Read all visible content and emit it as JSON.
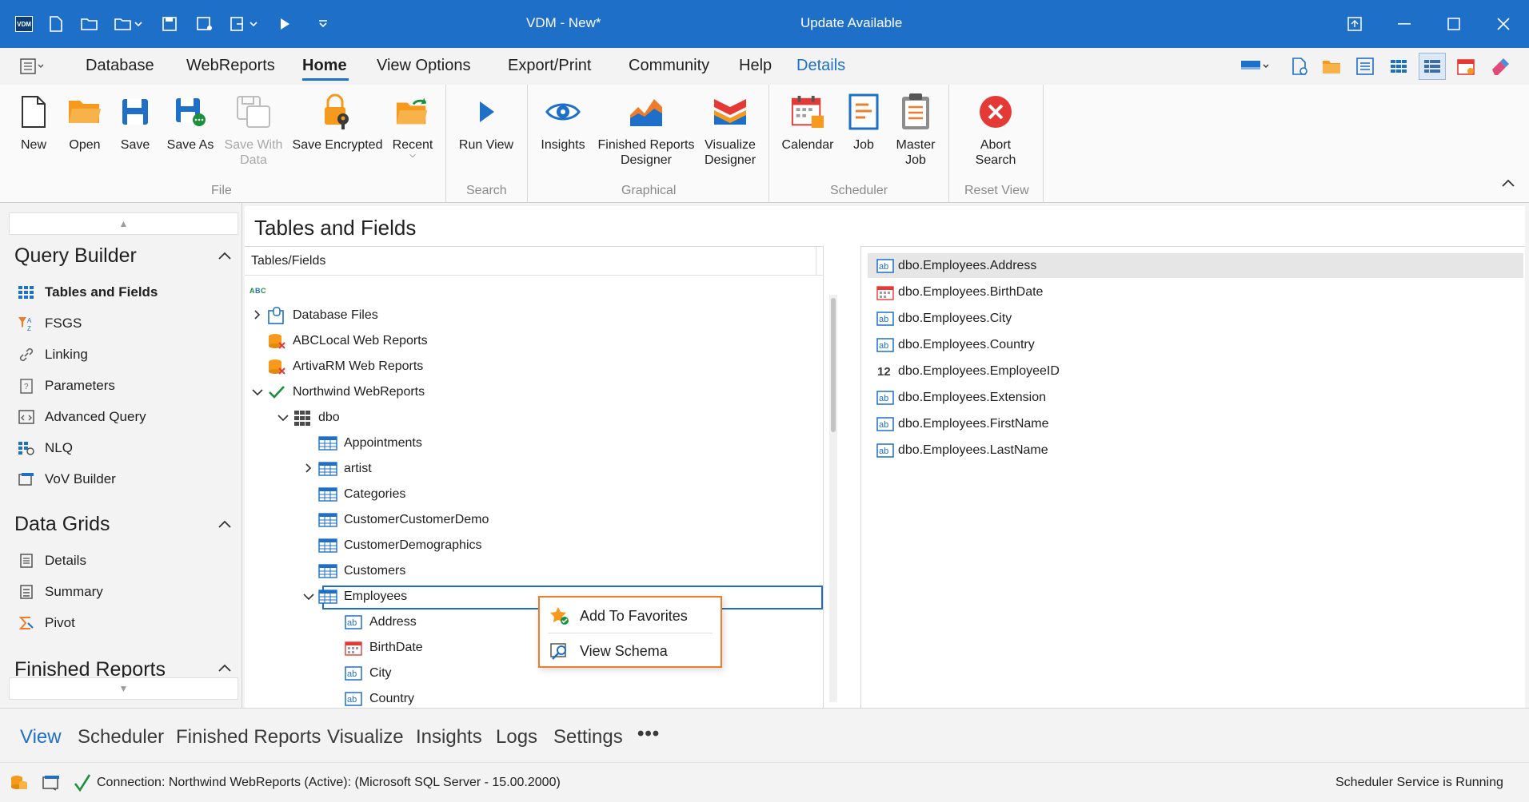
{
  "titlebar": {
    "app_logo": "VDM",
    "title": "VDM - New*",
    "update_notice": "Update Available"
  },
  "menu": {
    "items": [
      "Database",
      "WebReports",
      "Home",
      "View Options",
      "Export/Print",
      "Community",
      "Help",
      "Details"
    ],
    "active": "Home"
  },
  "ribbon": {
    "buttons": [
      {
        "label": "New",
        "icon": "new-file-icon"
      },
      {
        "label": "Open",
        "icon": "open-folder-icon"
      },
      {
        "label": "Save",
        "icon": "save-icon"
      },
      {
        "label": "Save As",
        "icon": "save-as-icon"
      },
      {
        "label": "Save With\nData",
        "icon": "save-with-data-icon",
        "disabled": true
      },
      {
        "label": "Save Encrypted",
        "icon": "lock-key-icon"
      },
      {
        "label": "Recent",
        "icon": "recent-folder-icon"
      },
      {
        "label": "Run View",
        "icon": "play-icon"
      },
      {
        "label": "Insights",
        "icon": "eye-icon"
      },
      {
        "label": "Finished Reports\nDesigner",
        "icon": "area-chart-icon"
      },
      {
        "label": "Visualize\nDesigner",
        "icon": "visualize-icon"
      },
      {
        "label": "Calendar",
        "icon": "calendar-icon"
      },
      {
        "label": "Job",
        "icon": "job-icon"
      },
      {
        "label": "Master\nJob",
        "icon": "clipboard-icon"
      },
      {
        "label": "Abort\nSearch",
        "icon": "abort-icon"
      }
    ],
    "groups": [
      "File",
      "Search",
      "Graphical",
      "Scheduler",
      "Reset View"
    ]
  },
  "leftnav": {
    "sections": [
      {
        "title": "Query Builder",
        "items": [
          "Tables and Fields",
          "FSGS",
          "Linking",
          "Parameters",
          "Advanced Query",
          "NLQ",
          "VoV Builder"
        ]
      },
      {
        "title": "Data Grids",
        "items": [
          "Details",
          "Summary",
          "Pivot"
        ]
      },
      {
        "title": "Finished Reports",
        "items": []
      }
    ]
  },
  "main": {
    "title": "Tables and Fields",
    "tree_header": "Tables/Fields",
    "tree": [
      {
        "label": "Database Files",
        "level": 0,
        "expander": "collapsed",
        "icon": "database-files-icon"
      },
      {
        "label": "ABCLocal Web Reports",
        "level": 0,
        "expander": "none",
        "icon": "database-error-icon"
      },
      {
        "label": "ArtivaRM Web Reports",
        "level": 0,
        "expander": "none",
        "icon": "database-error-icon"
      },
      {
        "label": "Northwind WebReports",
        "level": 0,
        "expander": "expanded",
        "icon": "check-icon"
      },
      {
        "label": "dbo",
        "level": 1,
        "expander": "expanded",
        "icon": "schema-grid-icon"
      },
      {
        "label": "Appointments",
        "level": 2,
        "expander": "none",
        "icon": "table-icon"
      },
      {
        "label": "artist",
        "level": 2,
        "expander": "collapsed",
        "icon": "table-icon"
      },
      {
        "label": "Categories",
        "level": 2,
        "expander": "none",
        "icon": "table-icon"
      },
      {
        "label": "CustomerCustomerDemo",
        "level": 2,
        "expander": "none",
        "icon": "table-icon"
      },
      {
        "label": "CustomerDemographics",
        "level": 2,
        "expander": "none",
        "icon": "table-icon"
      },
      {
        "label": "Customers",
        "level": 2,
        "expander": "none",
        "icon": "table-icon"
      },
      {
        "label": "Employees",
        "level": 2,
        "expander": "expanded",
        "icon": "table-icon",
        "selected": true
      },
      {
        "label": "Address",
        "level": 3,
        "expander": "none",
        "icon": "text-field-icon"
      },
      {
        "label": "BirthDate",
        "level": 3,
        "expander": "none",
        "icon": "date-field-icon"
      },
      {
        "label": "City",
        "level": 3,
        "expander": "none",
        "icon": "text-field-icon"
      },
      {
        "label": "Country",
        "level": 3,
        "expander": "none",
        "icon": "text-field-icon"
      }
    ],
    "fields": [
      {
        "label": "dbo.Employees.Address",
        "icon": "text-field-icon",
        "highlighted": true
      },
      {
        "label": "dbo.Employees.BirthDate",
        "icon": "date-field-icon"
      },
      {
        "label": "dbo.Employees.City",
        "icon": "text-field-icon"
      },
      {
        "label": "dbo.Employees.Country",
        "icon": "text-field-icon"
      },
      {
        "label": "dbo.Employees.EmployeeID",
        "icon": "numeric-field-icon"
      },
      {
        "label": "dbo.Employees.Extension",
        "icon": "text-field-icon"
      },
      {
        "label": "dbo.Employees.FirstName",
        "icon": "text-field-icon"
      },
      {
        "label": "dbo.Employees.LastName",
        "icon": "text-field-icon"
      }
    ]
  },
  "context_menu": {
    "items": [
      {
        "label": "Add To Favorites",
        "icon": "star-check-icon"
      },
      {
        "label": "View Schema",
        "icon": "view-schema-icon"
      }
    ]
  },
  "bottom_tabs": {
    "items": [
      "View",
      "Scheduler",
      "Finished Reports",
      "Visualize",
      "Insights",
      "Logs",
      "Settings"
    ],
    "active": "View",
    "more": "•••"
  },
  "status": {
    "connection": "Connection: Northwind WebReports (Active): (Microsoft SQL Server - 15.00.2000)",
    "scheduler": "Scheduler Service is Running"
  },
  "colors": {
    "accent": "#1e6fc8",
    "orange": "#f07c29",
    "titlebar": "#1e6fc8",
    "error_red": "#e53935",
    "green_check": "#1a8f3c"
  }
}
